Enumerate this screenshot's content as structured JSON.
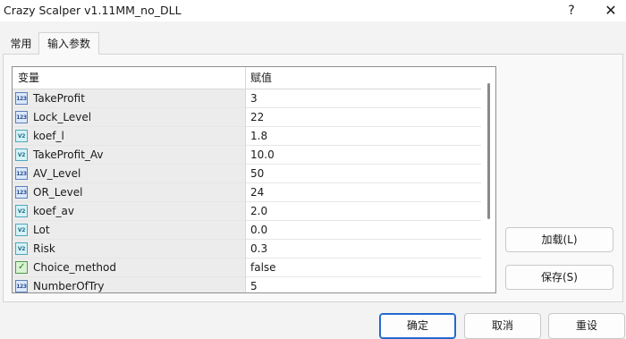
{
  "window": {
    "title": "Crazy Scalper v1.11MM_no_DLL",
    "help": "?",
    "close": "✕"
  },
  "tabs": [
    {
      "label": "常用",
      "active": false
    },
    {
      "label": "输入参数",
      "active": true
    }
  ],
  "grid": {
    "columns": [
      "变量",
      "赋值"
    ],
    "rows": [
      {
        "type": "int",
        "type_badge": "123",
        "name": "TakeProfit",
        "value": "3"
      },
      {
        "type": "int",
        "type_badge": "123",
        "name": "Lock_Level",
        "value": "22"
      },
      {
        "type": "double",
        "type_badge": "V2",
        "name": "koef_l",
        "value": "1.8"
      },
      {
        "type": "double",
        "type_badge": "V2",
        "name": "TakeProfit_Av",
        "value": "10.0"
      },
      {
        "type": "int",
        "type_badge": "123",
        "name": "AV_Level",
        "value": "50"
      },
      {
        "type": "int",
        "type_badge": "123",
        "name": "OR_Level",
        "value": "24"
      },
      {
        "type": "double",
        "type_badge": "V2",
        "name": "koef_av",
        "value": "2.0"
      },
      {
        "type": "double",
        "type_badge": "V2",
        "name": "Lot",
        "value": "0.0"
      },
      {
        "type": "double",
        "type_badge": "V2",
        "name": "Risk",
        "value": "0.3"
      },
      {
        "type": "bool",
        "type_badge": "✓",
        "name": "Choice_method",
        "value": "false"
      },
      {
        "type": "int",
        "type_badge": "123",
        "name": "NumberOfTry",
        "value": "5"
      }
    ]
  },
  "buttons": {
    "load": "加载(L)",
    "save": "保存(S)",
    "ok": "确定",
    "cancel": "取消",
    "reset": "重设"
  },
  "colors": {
    "accent": "#1f63c6",
    "row_label_bg": "#ececec"
  }
}
